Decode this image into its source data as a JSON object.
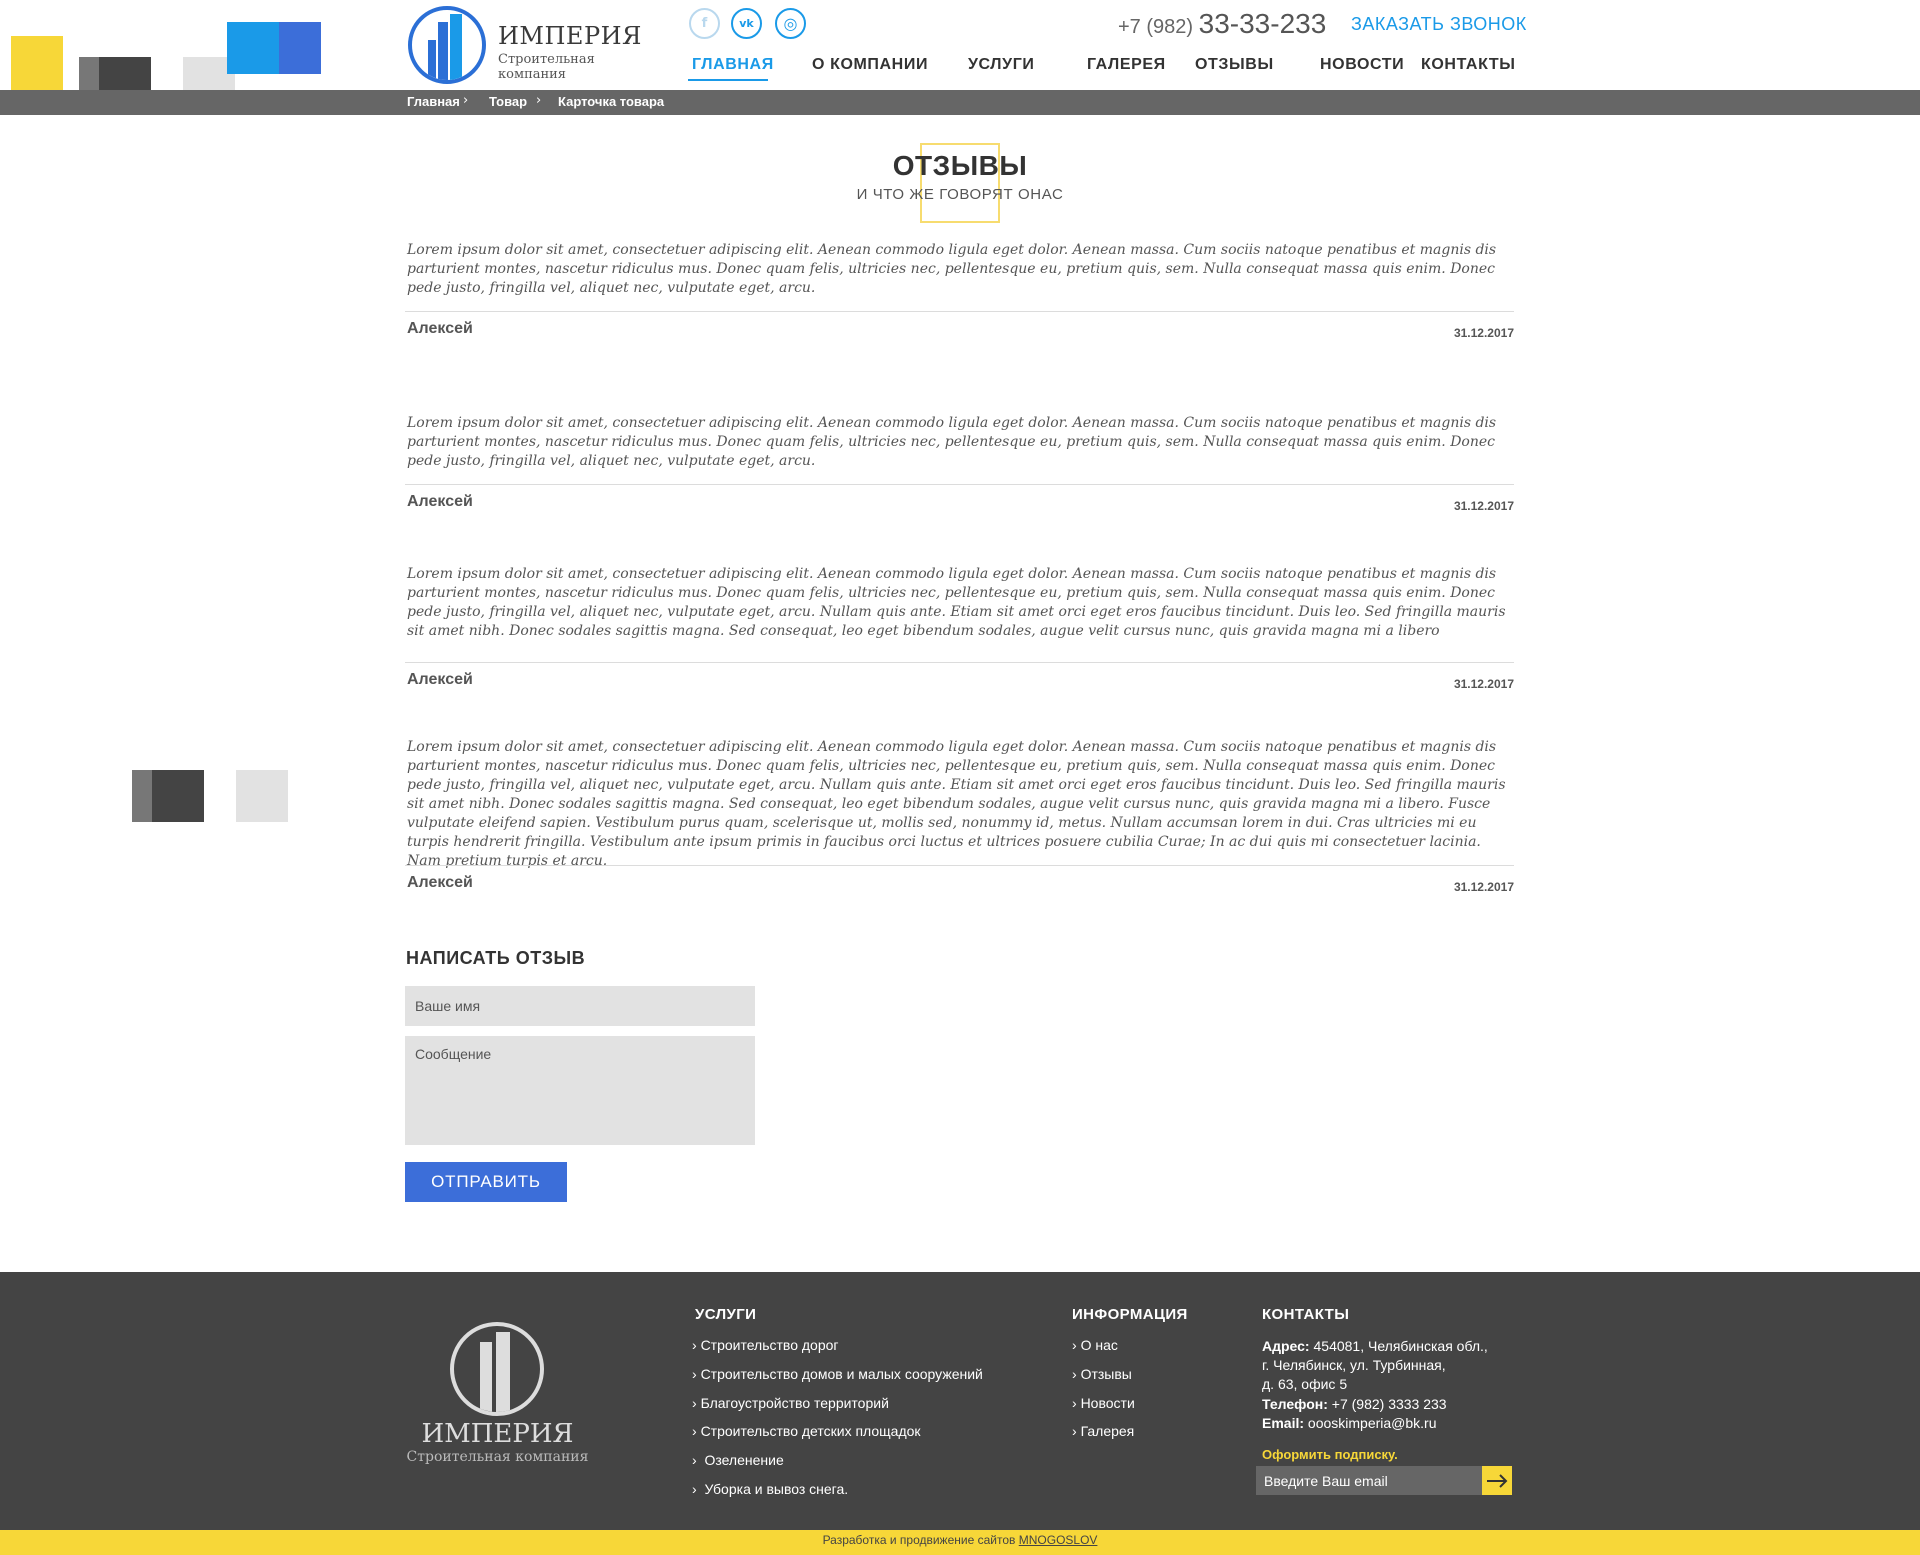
{
  "colors": {
    "accent_blue": "#1a9ae8",
    "button_blue": "#3c6ed9",
    "yellow": "#f7d738",
    "dark": "#444444",
    "breadcrumb_bar": "#666666"
  },
  "header": {
    "logo": {
      "title": "ИМПЕРИЯ",
      "subtitle": "Строительная компания"
    },
    "social": [
      {
        "icon": "facebook-icon",
        "glyph": "f"
      },
      {
        "icon": "vk-icon",
        "glyph": "vk"
      },
      {
        "icon": "instagram-icon",
        "glyph": "◎"
      }
    ],
    "phone_prefix": "+7 (982)",
    "phone_number": "33-33-233",
    "callback_label": "ЗАКАЗАТЬ ЗВОНОК",
    "nav": [
      "ГЛАВНАЯ",
      "О КОМПАНИИ",
      "УСЛУГИ",
      "ГАЛЕРЕЯ",
      "ОТЗЫВЫ",
      "НОВОСТИ",
      "КОНТАКТЫ"
    ],
    "nav_active": "ГЛАВНАЯ"
  },
  "breadcrumb": [
    "Главная",
    "Товар",
    "Карточка товара"
  ],
  "page": {
    "title": "ОТЗЫВЫ",
    "subtitle": "И ЧТО ЖЕ ГОВОРЯТ ОНАС"
  },
  "reviews": [
    {
      "text": "Lorem ipsum dolor sit amet, consectetuer adipiscing elit. Aenean commodo ligula eget dolor. Aenean massa. Cum sociis natoque penatibus et magnis dis parturient montes, nascetur ridiculus mus. Donec quam felis, ultricies nec, pellentesque eu, pretium quis, sem. Nulla consequat massa quis enim. Donec pede justo, fringilla vel, aliquet nec, vulputate eget, arcu.",
      "author": "Алексей",
      "date": "31.12.2017"
    },
    {
      "text": "Lorem ipsum dolor sit amet, consectetuer adipiscing elit. Aenean commodo ligula eget dolor. Aenean massa. Cum sociis natoque penatibus et magnis dis parturient montes, nascetur ridiculus mus. Donec quam felis, ultricies nec, pellentesque eu, pretium quis, sem. Nulla consequat massa quis enim. Donec pede justo, fringilla vel, aliquet nec, vulputate eget, arcu.",
      "author": "Алексей",
      "date": "31.12.2017"
    },
    {
      "text": "Lorem ipsum dolor sit amet, consectetuer adipiscing elit. Aenean commodo ligula eget dolor. Aenean massa. Cum sociis natoque penatibus et magnis dis parturient montes, nascetur ridiculus mus. Donec quam felis, ultricies nec, pellentesque eu, pretium quis, sem. Nulla consequat massa quis enim. Donec pede justo, fringilla vel, aliquet nec, vulputate eget, arcu. Nullam quis ante. Etiam sit amet orci eget eros faucibus tincidunt. Duis leo. Sed fringilla mauris sit amet nibh. Donec sodales sagittis magna. Sed consequat, leo eget bibendum sodales, augue velit cursus nunc, quis gravida magna mi a libero",
      "author": "Алексей",
      "date": "31.12.2017"
    },
    {
      "text": "Lorem ipsum dolor sit amet, consectetuer adipiscing elit. Aenean commodo ligula eget dolor. Aenean massa. Cum sociis natoque penatibus et magnis dis parturient montes, nascetur ridiculus mus. Donec quam felis, ultricies nec, pellentesque eu, pretium quis, sem. Nulla consequat massa quis enim. Donec pede justo, fringilla vel, aliquet nec, vulputate eget, arcu. Nullam quis ante. Etiam sit amet orci eget eros faucibus tincidunt. Duis leo. Sed fringilla mauris sit amet nibh. Donec sodales sagittis magna. Sed consequat, leo eget bibendum sodales, augue velit cursus nunc, quis gravida magna mi a libero. Fusce vulputate eleifend sapien. Vestibulum purus quam, scelerisque ut, mollis sed, nonummy id, metus. Nullam accumsan lorem in dui. Cras ultricies mi eu turpis hendrerit fringilla. Vestibulum ante ipsum primis in faucibus orci luctus et ultrices posuere cubilia Curae; In ac dui quis mi consectetuer lacinia. Nam pretium turpis et arcu.",
      "author": "Алексей",
      "date": "31.12.2017"
    }
  ],
  "form": {
    "title": "НАПИСАТЬ ОТЗЫВ",
    "name_placeholder": "Ваше имя",
    "message_placeholder": "Сообщение",
    "submit_label": "ОТПРАВИТЬ"
  },
  "footer": {
    "logo": {
      "title": "ИМПЕРИЯ",
      "subtitle": "Строительная компания"
    },
    "services_title": "УСЛУГИ",
    "services": [
      "Строительство дорог",
      "Строительство домов и малых сооружений",
      "Благоустройство территорий",
      "Строительство детских площадок",
      "Озеленение",
      "Уборка и вывоз снега."
    ],
    "info_title": "ИНФОРМАЦИЯ",
    "info": [
      "О нас",
      "Отзывы",
      "Новости",
      "Галерея"
    ],
    "contacts_title": "КОНТАКТЫ",
    "address_label": "Адрес:",
    "address_line1": "454081, Челябинская обл.,",
    "address_line2": "г. Челябинск, ул. Турбинная,",
    "address_line3": "д. 63, офис 5",
    "phone_label": "Телефон:",
    "phone": "+7 (982) 3333 233",
    "email_label": "Email:",
    "email": "oooskimperia@bk.ru",
    "subscribe_label": "Оформить подписку.",
    "subscribe_placeholder": "Введите Ваш email",
    "dev_text": "Разработка и продвижение сайтов",
    "dev_link": "MNOGOSLOV"
  }
}
